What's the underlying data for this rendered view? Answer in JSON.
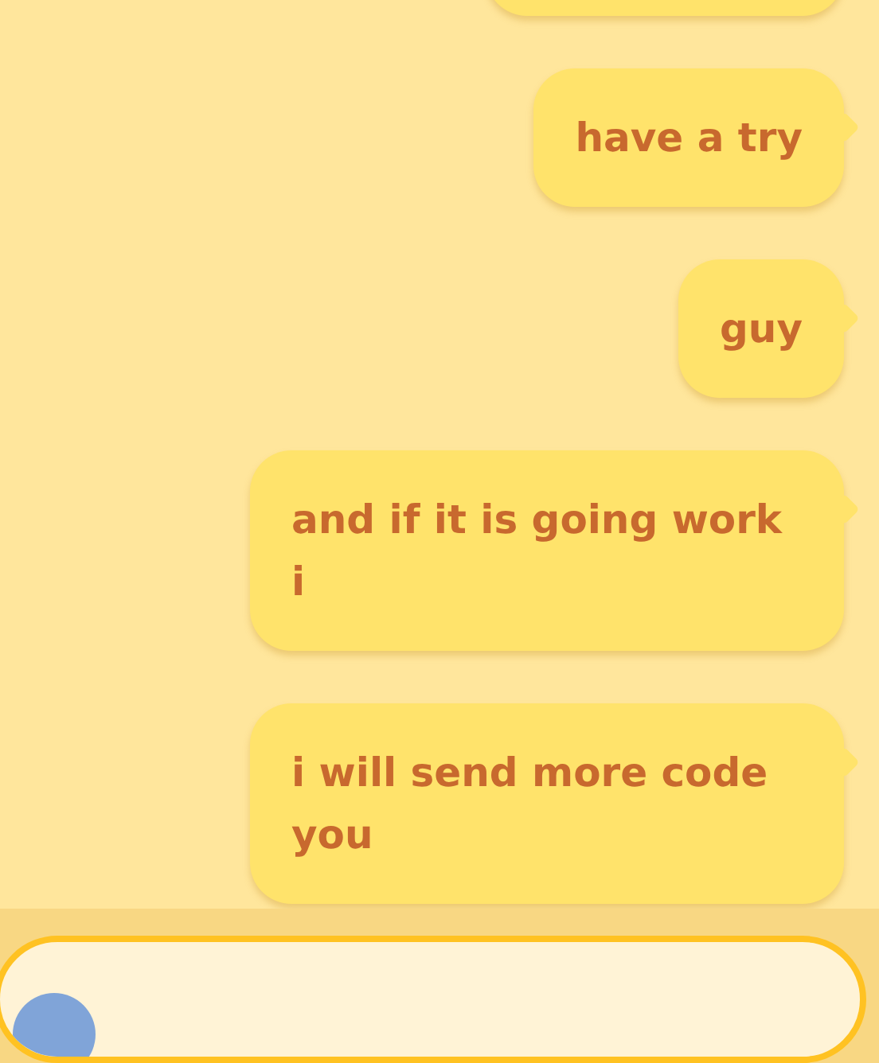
{
  "messages": [
    {
      "text": "have a try",
      "outgoing": true
    },
    {
      "text": "guy",
      "outgoing": true
    },
    {
      "text": "and if it is going work i",
      "outgoing": true
    },
    {
      "text": "i will send more code you",
      "outgoing": true
    }
  ]
}
